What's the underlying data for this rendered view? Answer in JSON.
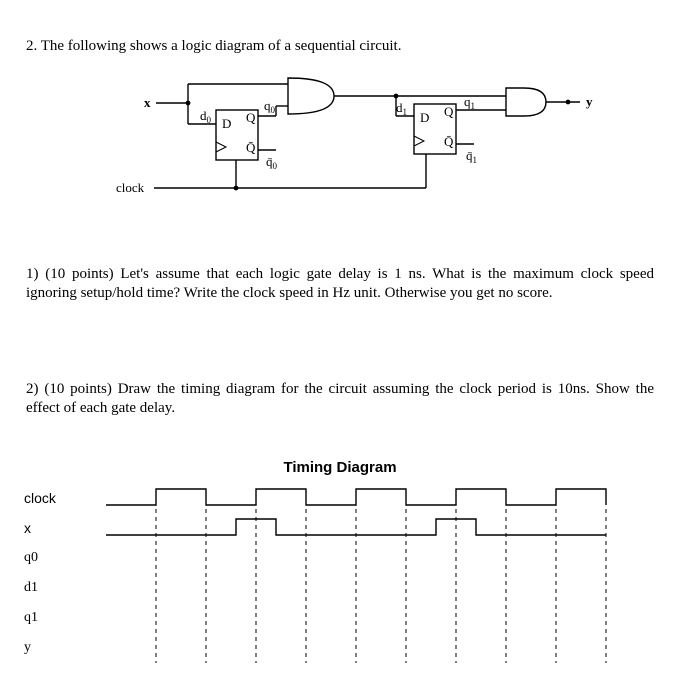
{
  "problem": {
    "header": "2. The following shows a logic diagram of a sequential circuit.",
    "part1": "1) (10 points) Let's assume that each logic gate delay is 1 ns. What is the maximum clock speed ignoring setup/hold time? Write the clock speed in Hz unit. Otherwise you get no score.",
    "part2": "2) (10 points) Draw the timing diagram for the circuit assuming the clock period is 10ns. Show the effect of each gate delay."
  },
  "circuit": {
    "input_x": "x",
    "output_y": "y",
    "clock": "clock",
    "ff0": {
      "d": "d",
      "d_sub": "0",
      "Q": "Q",
      "Qbar": "Q̄",
      "D": "D",
      "q": "q",
      "q_sub": "0",
      "qbar": "q̄",
      "qbar_sub": "0"
    },
    "ff1": {
      "d": "d",
      "d_sub": "1",
      "Q": "Q",
      "Qbar": "Q̄",
      "D": "D",
      "q": "q",
      "q_sub": "1",
      "qbar": "q̄",
      "qbar_sub": "1"
    }
  },
  "timing": {
    "title": "Timing Diagram",
    "signals": [
      "clock",
      "x",
      "q0",
      "d1",
      "q1",
      "y"
    ]
  },
  "chart_data": {
    "type": "timing-diagram",
    "time_unit": "ns",
    "clock_period": 10,
    "total_time": 50,
    "vertical_guides_t": [
      5,
      10,
      15,
      20,
      25,
      30,
      35,
      40,
      45,
      50
    ],
    "signals": [
      {
        "name": "clock",
        "waveform": [
          {
            "t": 0,
            "v": 0
          },
          {
            "t": 5,
            "v": 1
          },
          {
            "t": 10,
            "v": 0
          },
          {
            "t": 15,
            "v": 1
          },
          {
            "t": 20,
            "v": 0
          },
          {
            "t": 25,
            "v": 1
          },
          {
            "t": 30,
            "v": 0
          },
          {
            "t": 35,
            "v": 1
          },
          {
            "t": 40,
            "v": 0
          },
          {
            "t": 45,
            "v": 1
          },
          {
            "t": 50,
            "v": 0
          }
        ]
      },
      {
        "name": "x",
        "waveform": [
          {
            "t": 0,
            "v": 0
          },
          {
            "t": 13,
            "v": 1
          },
          {
            "t": 17,
            "v": 0
          },
          {
            "t": 33,
            "v": 1
          },
          {
            "t": 37,
            "v": 0
          },
          {
            "t": 50,
            "v": 0
          }
        ]
      },
      {
        "name": "q0",
        "waveform": null
      },
      {
        "name": "d1",
        "waveform": null
      },
      {
        "name": "q1",
        "waveform": null
      },
      {
        "name": "y",
        "waveform": null
      }
    ]
  }
}
